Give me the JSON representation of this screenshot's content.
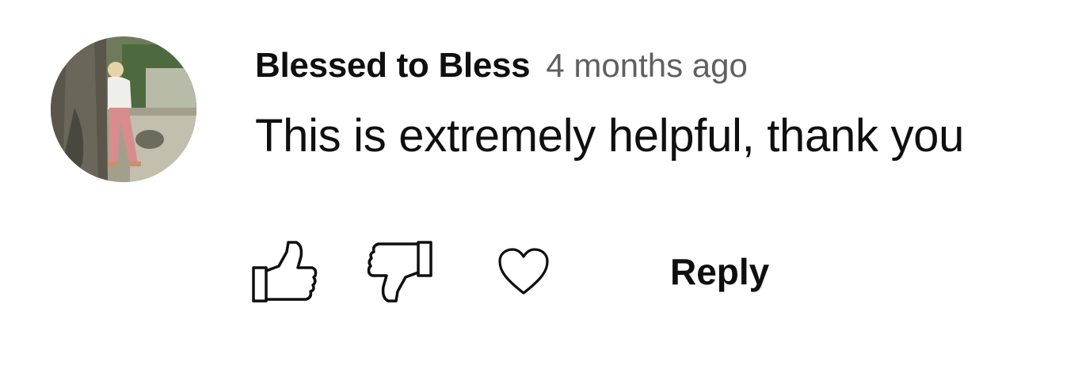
{
  "comment": {
    "author": "Blessed to Bless",
    "timestamp": "4 months ago",
    "text": "This is extremely helpful, thank you",
    "avatar_icon": "user-avatar-photo"
  },
  "actions": {
    "like_icon": "thumbs-up-icon",
    "dislike_icon": "thumbs-down-icon",
    "heart_icon": "heart-icon",
    "reply_label": "Reply"
  },
  "colors": {
    "text_primary": "#0f0f0f",
    "text_secondary": "#606060",
    "background": "#ffffff"
  }
}
